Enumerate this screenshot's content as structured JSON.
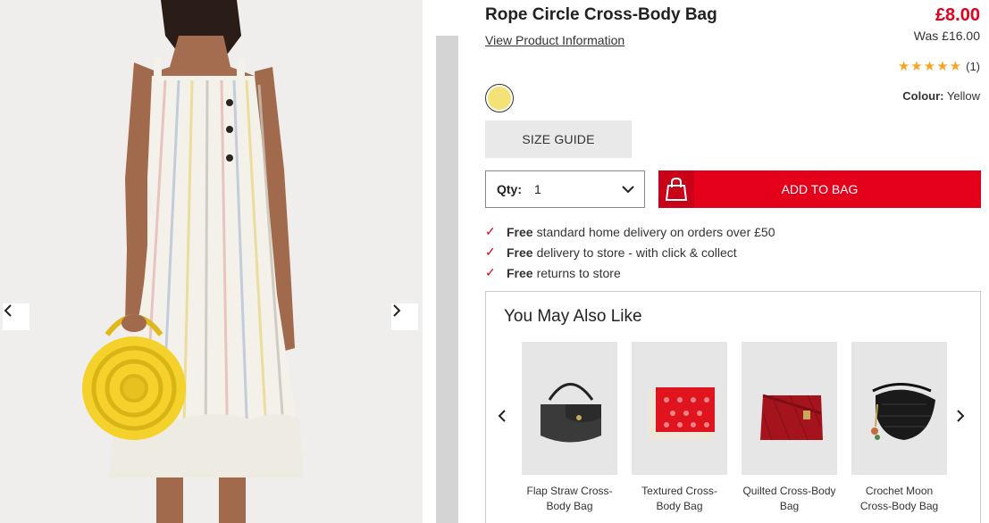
{
  "product": {
    "title": "Rope Circle Cross-Body Bag",
    "view_info": "View Product Information",
    "price": "£8.00",
    "was_price": "Was £16.00",
    "rating_stars": 5,
    "rating_count": "(1)",
    "colour_label": "Colour:",
    "colour_value": "Yellow",
    "swatch_color": "#f4e277"
  },
  "actions": {
    "size_guide": "SIZE GUIDE",
    "qty_label": "Qty:",
    "qty_value": "1",
    "add_to_bag": "ADD TO BAG"
  },
  "delivery": [
    {
      "bold": "Free",
      "text": "standard home delivery on orders over £50"
    },
    {
      "bold": "Free",
      "text": "delivery to store - with click & collect"
    },
    {
      "bold": "Free",
      "text": "returns to store"
    }
  ],
  "ymal": {
    "title": "You May Also Like",
    "items": [
      {
        "name": "Flap Straw Cross-Body Bag"
      },
      {
        "name": "Textured Cross-Body Bag"
      },
      {
        "name": "Quilted Cross-Body Bag"
      },
      {
        "name": "Crochet Moon Cross-Body Bag"
      }
    ]
  },
  "icons": {
    "gallery_prev": "chevron-left-icon",
    "gallery_next": "chevron-right-icon",
    "star": "star-icon",
    "tick": "check-icon",
    "bag": "shopping-bag-icon",
    "qty_dropdown": "chevron-down-icon"
  },
  "colors": {
    "accent_red": "#e4001b",
    "star_gold": "#f5a623",
    "bag_yellow": "#f4d22b"
  }
}
